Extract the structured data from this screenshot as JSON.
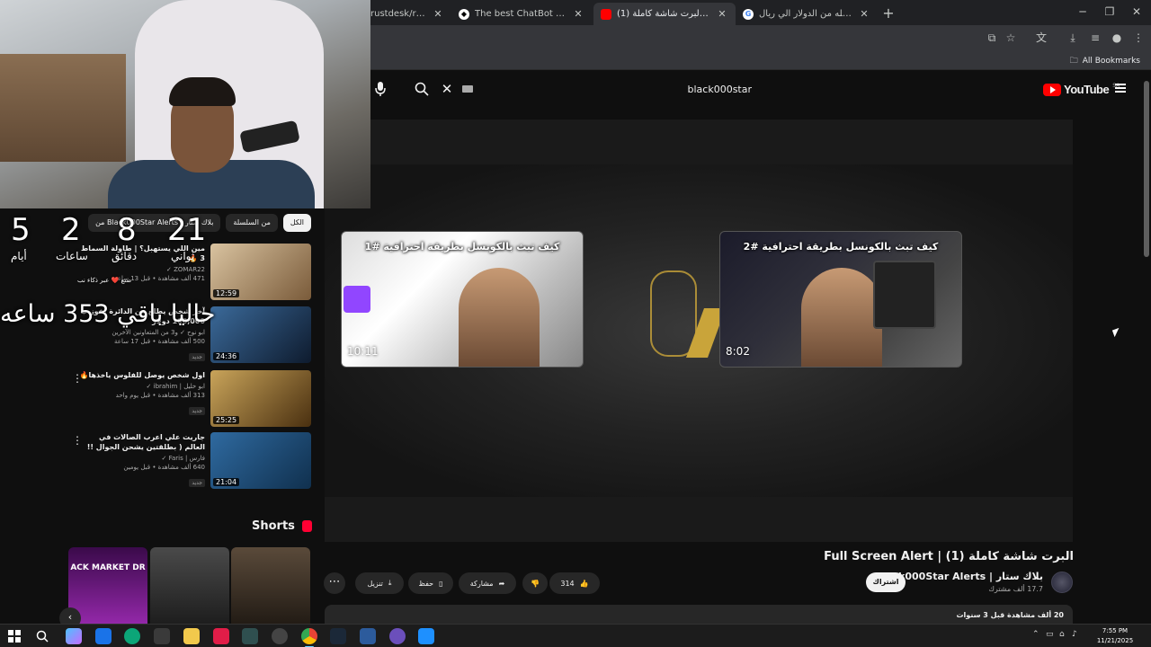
{
  "browser": {
    "tabs": [
      {
        "label": "rustdesk/rustdesk",
        "favicon": "github-icon"
      },
      {
        "label": "The best ChatBot and Widgets",
        "favicon": "chatbot-icon"
      },
      {
        "label": "(1) البرت شاشة كاملة - YouTube",
        "favicon": "youtube-icon",
        "active": true
      },
      {
        "label": "تحويل العمله من الدولار الي ريال",
        "favicon": "google-icon"
      }
    ],
    "new_tab": "+",
    "bookmarks_label": "All Bookmarks"
  },
  "youtube": {
    "search_query": "black000star",
    "logo_text": "YouTube",
    "region": "SA"
  },
  "video": {
    "title": "البرت شاشة كاملة (1) | Full Screen Alert",
    "channel": "Black000Star Alerts | بلاك ستار",
    "subscribers": "17.7 ألف مشترك",
    "subscribe_label": "اشتراك",
    "likes": "314",
    "share_label": "مشاركة",
    "save_label": "حفظ",
    "download_label": "تنزيل",
    "views_meta": "20 ألف مشاهدة  قبل 3 سنوات",
    "endcards": [
      {
        "title": "كيف تبث بالكونسل بطريقة احترافية #2",
        "duration": "8:02"
      },
      {
        "title": "كيف تبث بالكونسل بطريقة احترافية #1",
        "duration": "10:11"
      }
    ]
  },
  "sidebar": {
    "chips": [
      {
        "label": "الكل",
        "active": true
      },
      {
        "label": "من السلسلة"
      },
      {
        "label": "من Black000Star Alerts | بلاك ستار"
      }
    ],
    "related": [
      {
        "title": "مين اللي يستهبل؟ | طاولة السماط 3 🔥",
        "channel": "ZOMAR22 ✓",
        "meta": "471 ألف مشاهدة • قبل 13 ساعة",
        "badge": "جديد",
        "duration": "12:59",
        "colors": [
          "#d9c3a0",
          "#7a5b3a"
        ]
      },
      {
        "title": "آخر شخص يطلع من الدائرة يفوز ب 100,000 دولار",
        "channel": "ابو نوح ✓ و3 من المتعاونين الآخرين",
        "meta": "500 ألف مشاهدة • قبل 17 ساعة",
        "badge": "جديد",
        "duration": "24:36",
        "colors": [
          "#3b6a9a",
          "#0e1b2e"
        ]
      },
      {
        "title": "اول شخص يوصل للفلوس ياخذها🔥",
        "channel": "ابو خليل | ibrahim ✓",
        "meta": "313 ألف مشاهدة • قبل يوم واحد",
        "badge": "جديد",
        "duration": "25:25",
        "colors": [
          "#c9a45a",
          "#4a3010"
        ]
      },
      {
        "title": "جاريت علي اعرب الصالات في العالم ( بطلقتين يشحن الجوال !! 😨)",
        "channel": "فارس | Faris ✓",
        "meta": "640 ألف مشاهدة • قبل يومين",
        "badge": "جديد",
        "duration": "21:04",
        "colors": [
          "#2f6aa0",
          "#10304e"
        ]
      }
    ],
    "shorts_label": "Shorts",
    "short_text": "ACK MARKET DR"
  },
  "stream_overlay": {
    "timer": [
      {
        "value": "21",
        "label": "ثواني"
      },
      {
        "value": "8",
        "label": "دقائق"
      },
      {
        "value": "2",
        "label": "ساعات"
      },
      {
        "value": "5",
        "label": "أيام"
      }
    ],
    "hours_text": "حاليا باقي 353 ساعه",
    "caption": "صنع ❤️ عبر ذكاء نب"
  },
  "taskbar": {
    "time": "7:55 PM",
    "date": "11/21/2025",
    "lang": "ع"
  }
}
